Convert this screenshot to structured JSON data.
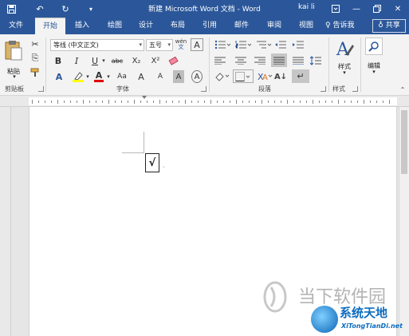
{
  "colors": {
    "brand": "#2b579a",
    "ribbon_bg": "#f3f3f3",
    "page_bg": "#ffffff",
    "highlight_yellow": "#ffff00",
    "font_red": "#e00000",
    "watermark_blue": "#0c6cc1"
  },
  "titlebar": {
    "title": "新建 Microsoft Word 文档  -  Word",
    "user": "kai li",
    "icons": [
      "save-icon",
      "undo-icon",
      "redo-icon",
      "customize-toolbar-icon",
      "ribbon-display-options-icon",
      "minimize-icon",
      "restore-icon",
      "close-icon"
    ]
  },
  "tabs": [
    {
      "label": "文件"
    },
    {
      "label": "开始"
    },
    {
      "label": "插入"
    },
    {
      "label": "绘图"
    },
    {
      "label": "设计"
    },
    {
      "label": "布局"
    },
    {
      "label": "引用"
    },
    {
      "label": "邮件"
    },
    {
      "label": "审阅"
    },
    {
      "label": "视图"
    }
  ],
  "tell_me": "♀ 告诉我",
  "share": "♁ 共享",
  "ribbon": {
    "clipboard": {
      "paste_label": "粘贴",
      "group_label": "剪贴板"
    },
    "font": {
      "font_name": "等线 (中文正文)",
      "font_size": "五号",
      "group_label": "字体",
      "bold": "B",
      "italic": "I",
      "underline": "U",
      "strike": "abc",
      "subscript": "X₂",
      "superscript": "X²",
      "change_case": "Aa",
      "grow": "A",
      "shrink": "A",
      "clear_format": "A",
      "char_shade": "A",
      "char_border": "A",
      "phonetic": "wén"
    },
    "paragraph": {
      "group_label": "段落"
    },
    "styles": {
      "label": "样式",
      "group_label": "样式"
    },
    "editing": {
      "label": "编辑"
    }
  },
  "document": {
    "content": "√",
    "para_mark": "↵"
  },
  "watermark": {
    "line1": "当下软件园",
    "line2": "系统天地",
    "url": "XiTongTianDi.net"
  }
}
